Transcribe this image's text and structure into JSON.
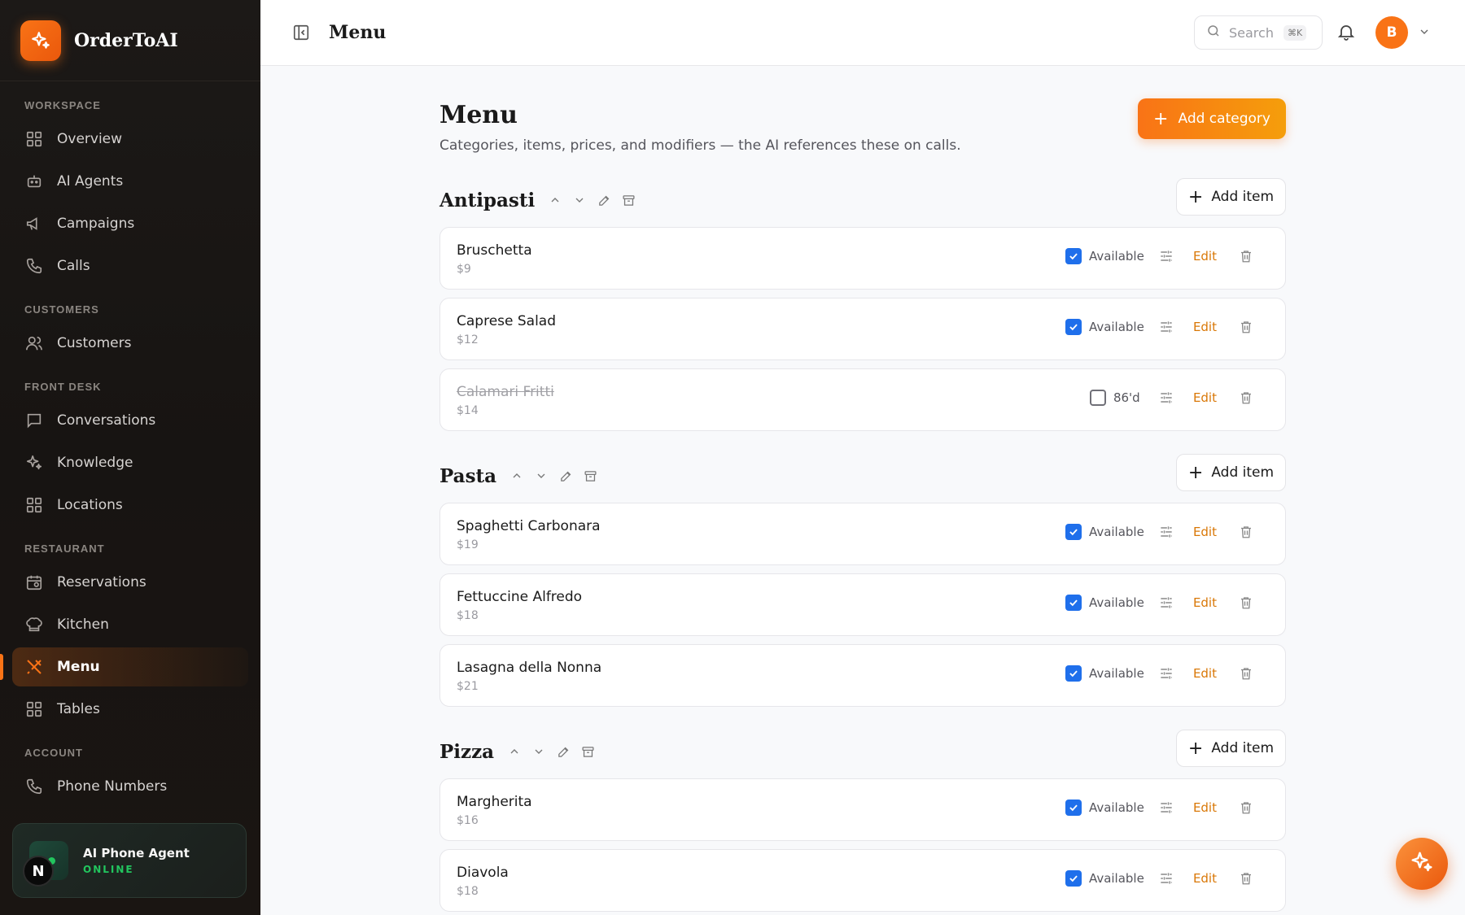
{
  "brand": {
    "name": "OrderToAI"
  },
  "sidebar": {
    "sections": [
      {
        "label": "WORKSPACE",
        "items": [
          {
            "label": "Overview",
            "icon": "grid-icon"
          },
          {
            "label": "AI Agents",
            "icon": "bot-icon"
          },
          {
            "label": "Campaigns",
            "icon": "megaphone-icon"
          },
          {
            "label": "Calls",
            "icon": "phone-icon"
          }
        ]
      },
      {
        "label": "CUSTOMERS",
        "items": [
          {
            "label": "Customers",
            "icon": "users-icon"
          }
        ]
      },
      {
        "label": "FRONT DESK",
        "items": [
          {
            "label": "Conversations",
            "icon": "chat-icon"
          },
          {
            "label": "Knowledge",
            "icon": "sparkles-icon"
          },
          {
            "label": "Locations",
            "icon": "grid-icon"
          }
        ]
      },
      {
        "label": "RESTAURANT",
        "items": [
          {
            "label": "Reservations",
            "icon": "calendar-icon"
          },
          {
            "label": "Kitchen",
            "icon": "chef-hat-icon"
          },
          {
            "label": "Menu",
            "icon": "utensils-icon",
            "active": true
          },
          {
            "label": "Tables",
            "icon": "grid-icon"
          }
        ]
      },
      {
        "label": "ACCOUNT",
        "items": [
          {
            "label": "Phone Numbers",
            "icon": "phone-icon"
          }
        ]
      }
    ],
    "agent": {
      "title": "AI Phone Agent",
      "status": "ONLINE",
      "badge": "N"
    }
  },
  "topbar": {
    "title": "Menu",
    "search_label": "Search",
    "search_kbd": "⌘K",
    "avatar_initial": "B"
  },
  "page": {
    "title": "Menu",
    "subtitle": "Categories, items, prices, and modifiers — the AI references these on calls.",
    "add_category_label": "Add category",
    "add_item_label": "Add item",
    "edit_label": "Edit"
  },
  "categories": [
    {
      "name": "Antipasti",
      "items": [
        {
          "name": "Bruschetta",
          "price": "$9",
          "available": true,
          "status": "Available"
        },
        {
          "name": "Caprese Salad",
          "price": "$12",
          "available": true,
          "status": "Available"
        },
        {
          "name": "Calamari Fritti",
          "price": "$14",
          "available": false,
          "status": "86'd"
        }
      ]
    },
    {
      "name": "Pasta",
      "items": [
        {
          "name": "Spaghetti Carbonara",
          "price": "$19",
          "available": true,
          "status": "Available"
        },
        {
          "name": "Fettuccine Alfredo",
          "price": "$18",
          "available": true,
          "status": "Available"
        },
        {
          "name": "Lasagna della Nonna",
          "price": "$21",
          "available": true,
          "status": "Available"
        }
      ]
    },
    {
      "name": "Pizza",
      "items": [
        {
          "name": "Margherita",
          "price": "$16",
          "available": true,
          "status": "Available"
        },
        {
          "name": "Diavola",
          "price": "$18",
          "available": true,
          "status": "Available"
        }
      ]
    }
  ],
  "colors": {
    "accent": "#f97316",
    "checkbox": "#1f6feb",
    "edit": "#d97706"
  }
}
